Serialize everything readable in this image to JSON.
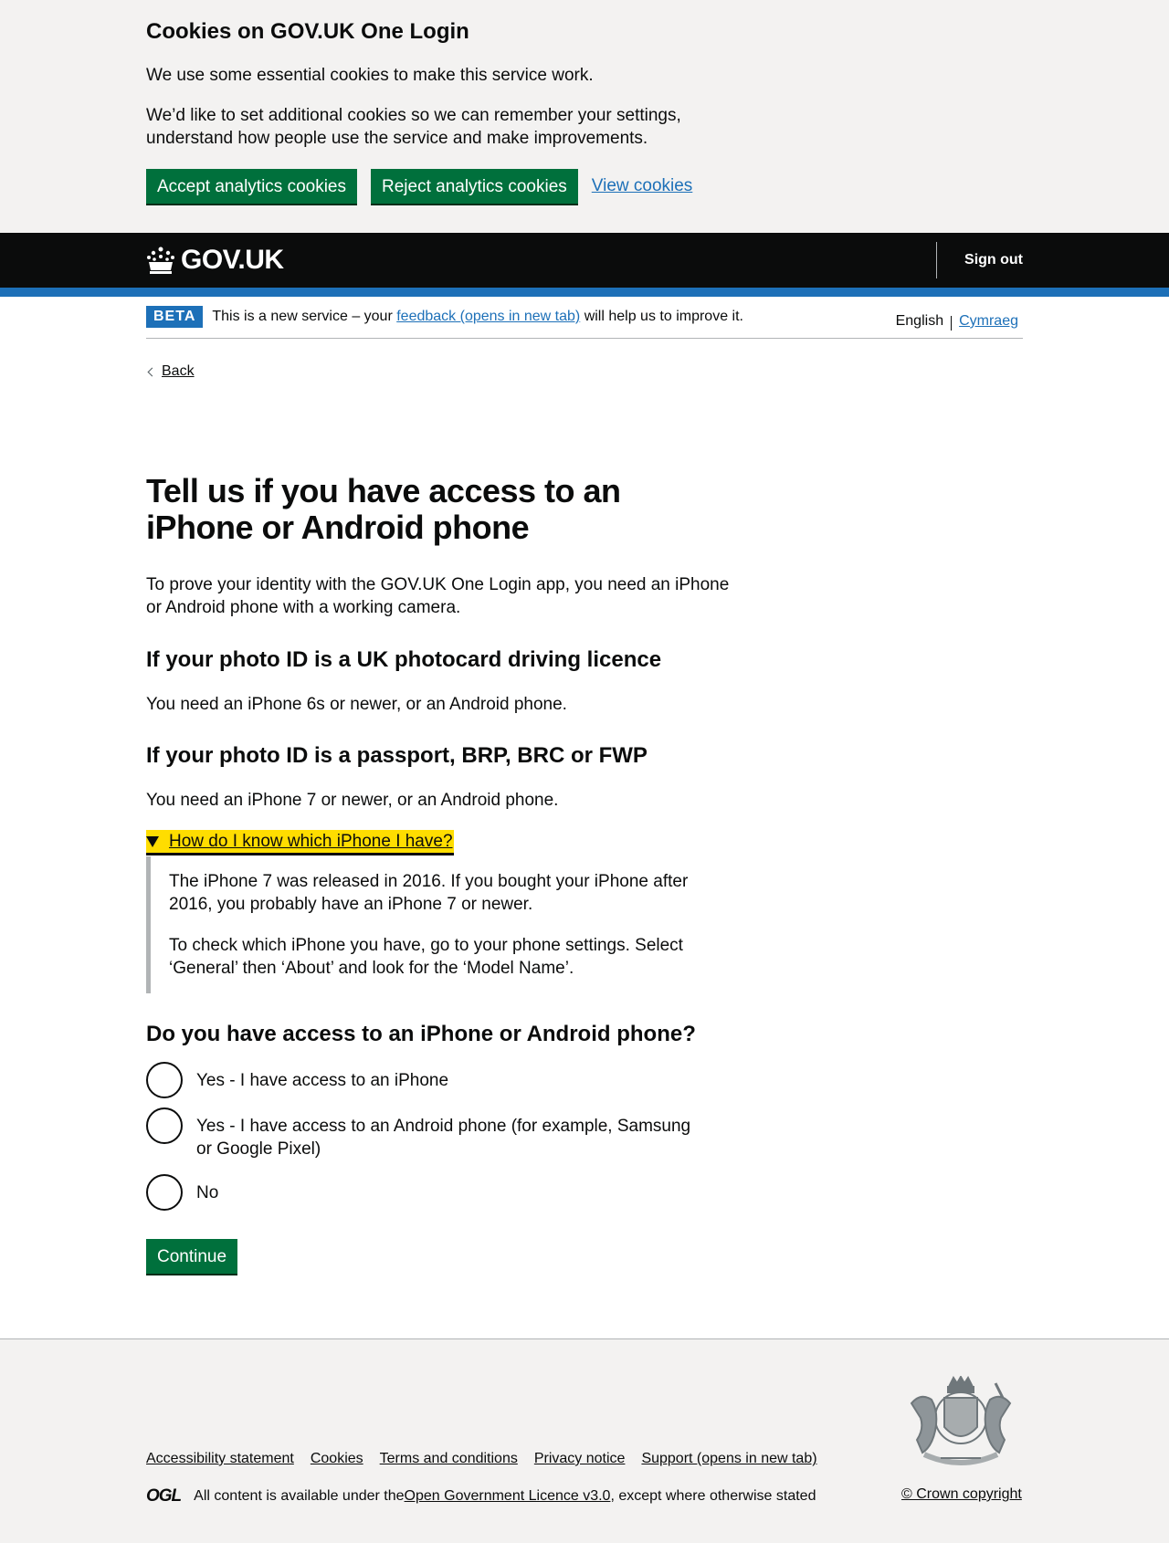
{
  "cookie_banner": {
    "title": "Cookies on GOV.UK One Login",
    "para1": "We use some essential cookies to make this service work.",
    "para2": "We’d like to set additional cookies so we can remember your settings, understand how people use the service and make improvements.",
    "accept_label": "Accept analytics cookies",
    "reject_label": "Reject analytics cookies",
    "view_label": "View cookies"
  },
  "header": {
    "logo_text": "GOV.UK",
    "sign_out_label": "Sign out"
  },
  "phase_banner": {
    "tag": "BETA",
    "text_before": "This is a new service – your ",
    "link_text": "feedback (opens in new tab)",
    "text_after": " will help us to improve it."
  },
  "language": {
    "current": "English",
    "other": "Cymraeg"
  },
  "back_label": "Back",
  "page": {
    "title": "Tell us if you have access to an iPhone or Android phone",
    "intro": "To prove your identity with the GOV.UK One Login app, you need an iPhone or Android phone with a working camera.",
    "section1_heading": "If your photo ID is a UK photocard driving licence",
    "section1_text": "You need an iPhone 6s or newer, or an Android phone.",
    "section2_heading": "If your photo ID is a passport, BRP, BRC or FWP",
    "section2_text": "You need an iPhone 7 or newer, or an Android phone.",
    "details_summary": "How do I know which iPhone I have?",
    "details_para1": "The iPhone 7 was released in 2016. If you bought your iPhone after 2016, you probably have an iPhone 7 or newer.",
    "details_para2": "To check which iPhone you have, go to your phone settings. Select ‘General’ then ‘About’ and look for the ‘Model Name’.",
    "question": "Do you have access to an iPhone or Android phone?",
    "options": [
      "Yes - I have access to an iPhone",
      "Yes - I have access to an Android phone (for example, Samsung or Google Pixel)",
      "No"
    ],
    "continue_label": "Continue"
  },
  "footer": {
    "links": [
      "Accessibility statement",
      "Cookies",
      "Terms and conditions",
      "Privacy notice",
      "Support (opens in new tab)"
    ],
    "ogl_logo": "OGL",
    "licence_before": "All content is available under the ",
    "licence_link": "Open Government Licence v3.0",
    "licence_after": ", except where otherwise stated",
    "copyright": "© Crown copyright"
  }
}
